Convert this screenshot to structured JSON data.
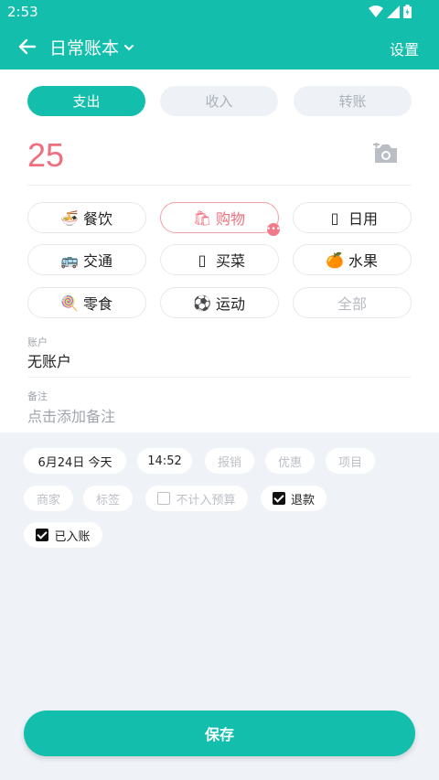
{
  "status_bar": {
    "time": "2:53"
  },
  "app_bar": {
    "title": "日常账本",
    "settings_label": "设置"
  },
  "type_tabs": [
    {
      "label": "支出",
      "active": true
    },
    {
      "label": "收入",
      "active": false
    },
    {
      "label": "转账",
      "active": false
    }
  ],
  "amount": "25",
  "categories": [
    {
      "label": "餐饮",
      "icon": "noodle-bowl-icon",
      "emoji": "🍜"
    },
    {
      "label": "购物",
      "icon": "shopping-bag-icon",
      "emoji": "🛍",
      "selected": true
    },
    {
      "label": "日用",
      "icon": "daily-use-icon",
      "emoji": "▯"
    },
    {
      "label": "交通",
      "icon": "bus-icon",
      "emoji": "🚌"
    },
    {
      "label": "买菜",
      "icon": "vegetable-icon",
      "emoji": "▯"
    },
    {
      "label": "水果",
      "icon": "orange-icon",
      "emoji": "🍊"
    },
    {
      "label": "零食",
      "icon": "lollipop-icon",
      "emoji": "🍭"
    },
    {
      "label": "运动",
      "icon": "soccer-ball-icon",
      "emoji": "⚽"
    },
    {
      "label": "全部",
      "muted": true
    }
  ],
  "account": {
    "label": "账户",
    "value": "无账户"
  },
  "note": {
    "label": "备注",
    "placeholder": "点击添加备注"
  },
  "options": {
    "date": "6月24日  今天",
    "time": "14:52",
    "reimburse": "报销",
    "discount": "优惠",
    "project": "项目",
    "merchant": "商家",
    "tag": "标签",
    "exclude_budget": {
      "label": "不计入预算",
      "checked": false
    },
    "refund": {
      "label": "退款",
      "checked": true
    },
    "recorded": {
      "label": "已入账",
      "checked": true
    }
  },
  "save_label": "保存",
  "colors": {
    "primary": "#13bfac",
    "accent": "#ee6f7e",
    "background": "#eff3f8"
  }
}
